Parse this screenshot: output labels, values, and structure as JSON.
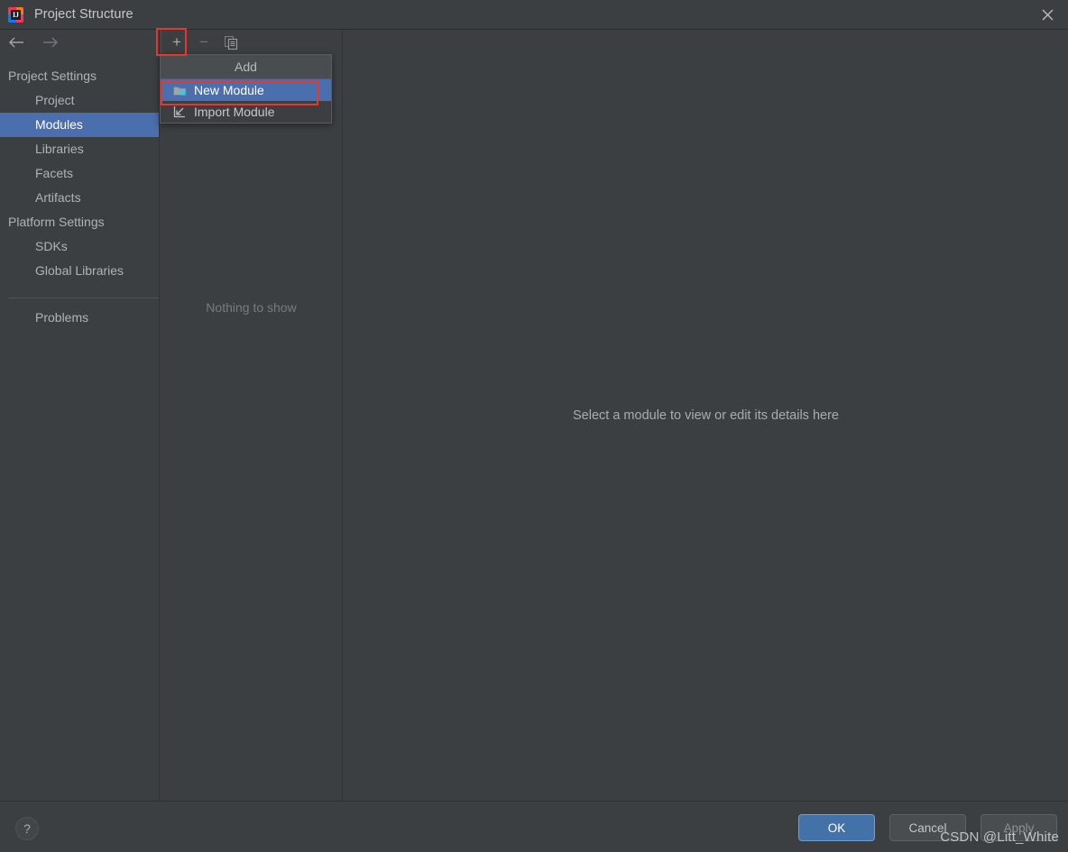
{
  "window": {
    "title": "Project Structure",
    "app_icon": "intellij-idea-logo",
    "close_label": "✕"
  },
  "sidebar": {
    "nav": {
      "back_icon": "arrow-left-icon",
      "forward_icon": "arrow-right-icon"
    },
    "groups": [
      {
        "label": "Project Settings",
        "items": [
          {
            "label": "Project",
            "selected": false
          },
          {
            "label": "Modules",
            "selected": true
          },
          {
            "label": "Libraries",
            "selected": false
          },
          {
            "label": "Facets",
            "selected": false
          },
          {
            "label": "Artifacts",
            "selected": false
          }
        ]
      },
      {
        "label": "Platform Settings",
        "items": [
          {
            "label": "SDKs",
            "selected": false
          },
          {
            "label": "Global Libraries",
            "selected": false
          }
        ]
      }
    ],
    "problems": {
      "label": "Problems",
      "selected": false
    }
  },
  "midpanel": {
    "toolbar": {
      "add_icon": "plus-icon",
      "add_label": "+",
      "remove_icon": "minus-icon",
      "remove_label": "−",
      "copy_icon": "copy-icon"
    },
    "empty_text": "Nothing to show"
  },
  "dropdown": {
    "header": "Add",
    "items": [
      {
        "label": "New Module",
        "icon": "new-folder-icon",
        "selected": true
      },
      {
        "label": "Import Module",
        "icon": "import-arrow-icon",
        "selected": false
      }
    ]
  },
  "detail": {
    "message": "Select a module to view or edit its details here"
  },
  "footer": {
    "help_label": "?",
    "buttons": [
      {
        "label": "OK",
        "style": "primary"
      },
      {
        "label": "Cancel",
        "style": "default"
      },
      {
        "label": "Apply",
        "style": "disabled"
      }
    ]
  },
  "watermark": "CSDN @Litt_White",
  "colors": {
    "window_bg": "#3c3f41",
    "selection_blue": "#4b6eaf",
    "primary_button": "#4372a8",
    "annotation_red": "#e8362c",
    "border": "#323232"
  }
}
